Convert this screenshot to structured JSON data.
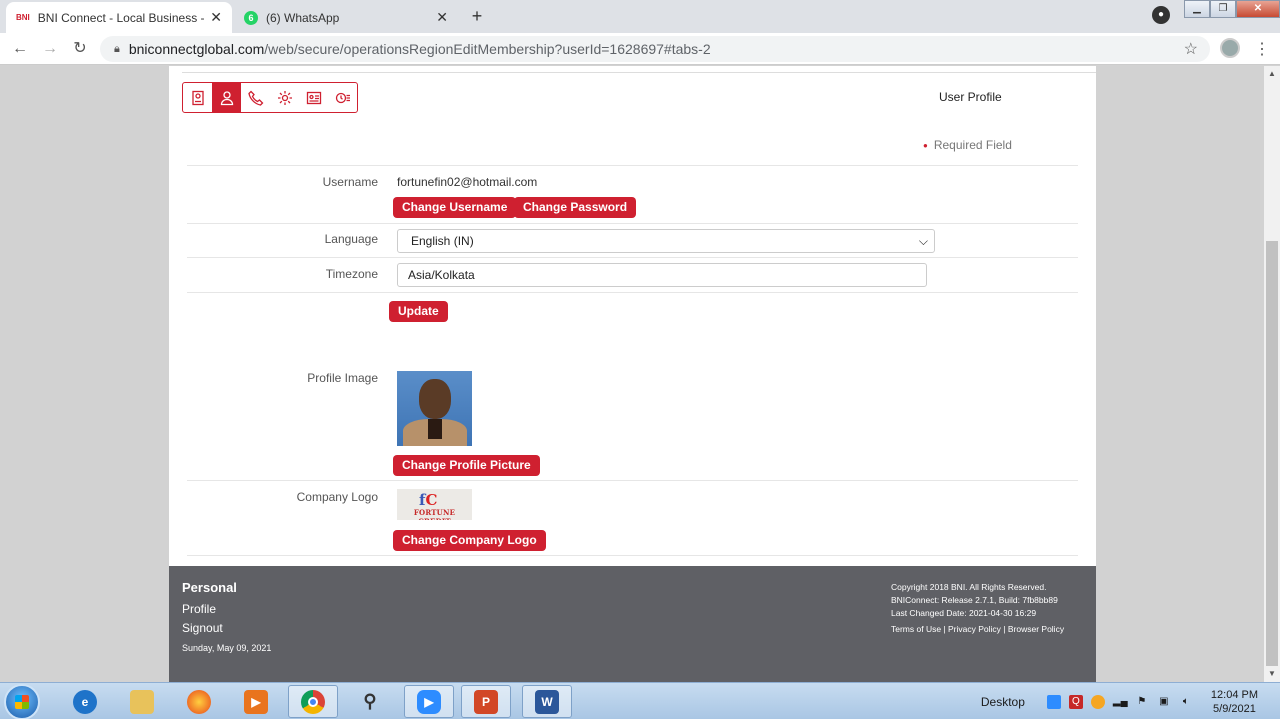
{
  "browser": {
    "tabs": [
      {
        "favicon": "BNI",
        "title": "BNI Connect - Local Business - G",
        "close": "✕"
      },
      {
        "favicon": "6",
        "title": "(6) WhatsApp",
        "close": "✕"
      }
    ],
    "new_tab": "+",
    "url_host": "bniconnectglobal.com",
    "url_path": "/web/secure/operationsRegionEditMembership?userId=1628697#tabs-2"
  },
  "page": {
    "icon_tabs": [
      "id-card-icon",
      "user-icon",
      "phone-icon",
      "settings-icon",
      "address-card-icon",
      "clock-list-icon"
    ],
    "active_icon_tab": 1,
    "heading": "User Profile",
    "required_field": "Required Field",
    "username_label": "Username",
    "username_value": "fortunefin02@hotmail.com",
    "change_username": "Change Username",
    "change_password": "Change Password",
    "language_label": "Language",
    "language_value": "English (IN)",
    "timezone_label": "Timezone",
    "timezone_value": "Asia/Kolkata",
    "update": "Update",
    "profile_image_label": "Profile Image",
    "change_profile_picture": "Change Profile Picture",
    "company_logo_label": "Company Logo",
    "change_company_logo": "Change Company Logo"
  },
  "footer": {
    "title": "Personal",
    "links": [
      "Profile",
      "Signout"
    ],
    "date": "Sunday, May 09, 2021",
    "copyright": "Copyright 2018 BNI. All Rights Reserved.",
    "release": "BNIConnect: Release 2.7.1, Build: 7fb8bb89",
    "last_changed": "Last Changed Date: 2021-04-30 16:29",
    "terms": "Terms of Use",
    "privacy": "Privacy Policy",
    "browser_policy": "Browser Policy"
  },
  "taskbar": {
    "desktop_label": "Desktop",
    "time": "12:04 PM",
    "date": "5/9/2021"
  }
}
